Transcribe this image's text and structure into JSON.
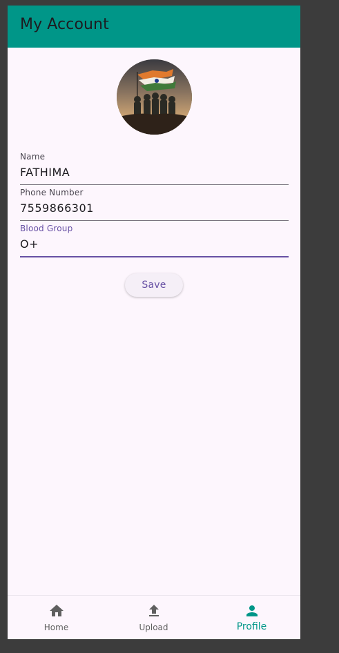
{
  "appbar": {
    "title": "My Account"
  },
  "profile": {
    "avatar_icon": "soldiers-with-flag-photo"
  },
  "form": {
    "name": {
      "label": "Name",
      "value": "FATHIMA"
    },
    "phone": {
      "label": "Phone Number",
      "value": "7559866301"
    },
    "blood_group": {
      "label": "Blood Group",
      "value": "O+"
    }
  },
  "actions": {
    "save_label": "Save"
  },
  "nav": {
    "items": [
      {
        "label": "Home",
        "icon": "home-icon"
      },
      {
        "label": "Upload",
        "icon": "upload-icon"
      },
      {
        "label": "Profile",
        "icon": "person-icon"
      }
    ],
    "active": "Profile"
  },
  "colors": {
    "appbar": "#009688",
    "accent": "#6750a4",
    "active_nav": "#009688",
    "background": "#fdf6fd"
  }
}
